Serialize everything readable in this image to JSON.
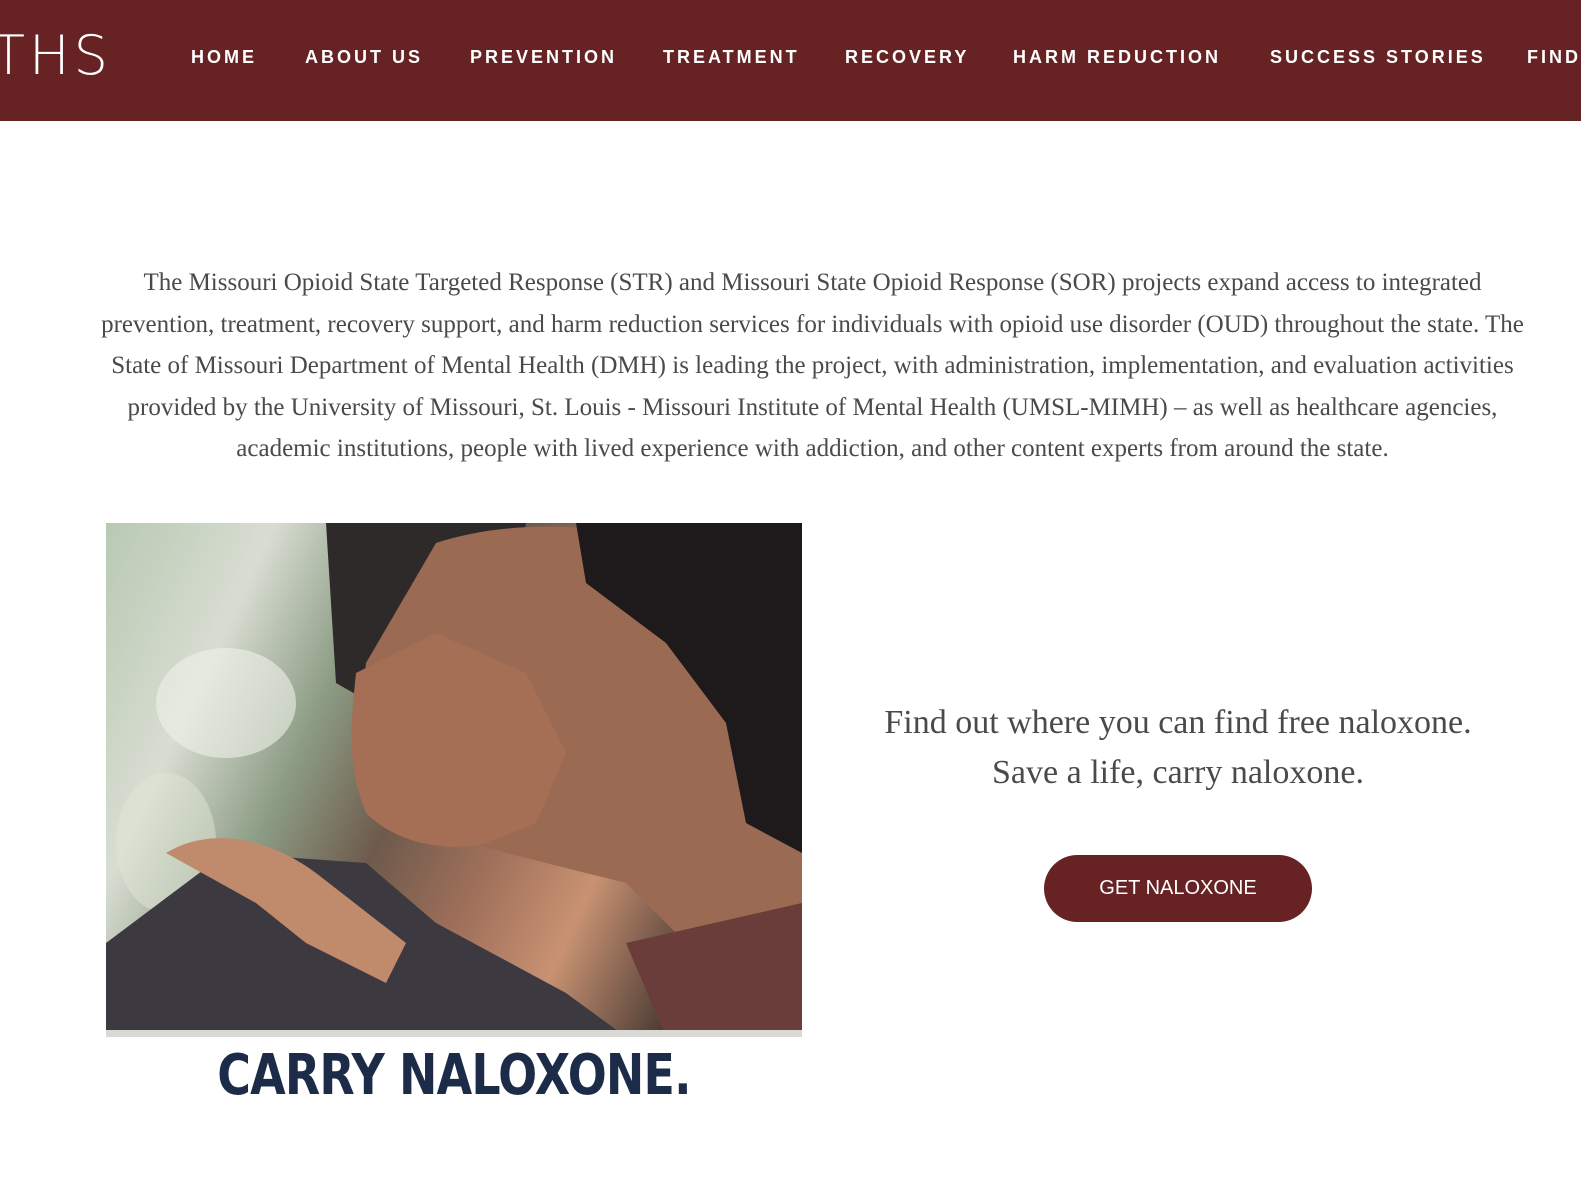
{
  "header": {
    "logo_text": "THS",
    "nav": [
      {
        "label": "HOME"
      },
      {
        "label": "ABOUT US"
      },
      {
        "label": "PREVENTION"
      },
      {
        "label": "TREATMENT"
      },
      {
        "label": "RECOVERY"
      },
      {
        "label": "HARM REDUCTION"
      },
      {
        "label": "SUCCESS STORIES"
      },
      {
        "label": "FIND"
      }
    ]
  },
  "intro": {
    "text": "The Missouri Opioid State Targeted Response (STR) and Missouri State Opioid Response (SOR) projects expand access to integrated prevention, treatment, recovery support, and harm reduction services for individuals with opioid use disorder (OUD) throughout the state. The State of Missouri Department of Mental Health (DMH) is leading the project, with administration, implementation, and evaluation activities provided by the University of Missouri, St. Louis - Missouri Institute of Mental Health (UMSL-MIMH) – as well as healthcare agencies, academic institutions, people with lived experience with addiction, and other content experts from around the state."
  },
  "feature": {
    "image_caption": "CARRY NALOXONE.",
    "promo_line1": "Find out where you can find free naloxone.",
    "promo_line2": "Save a life, carry naloxone.",
    "button_label": "GET NALOXONE"
  },
  "colors": {
    "brand": "#672324",
    "text": "#4a4a4a",
    "caption": "#1c2b47"
  }
}
